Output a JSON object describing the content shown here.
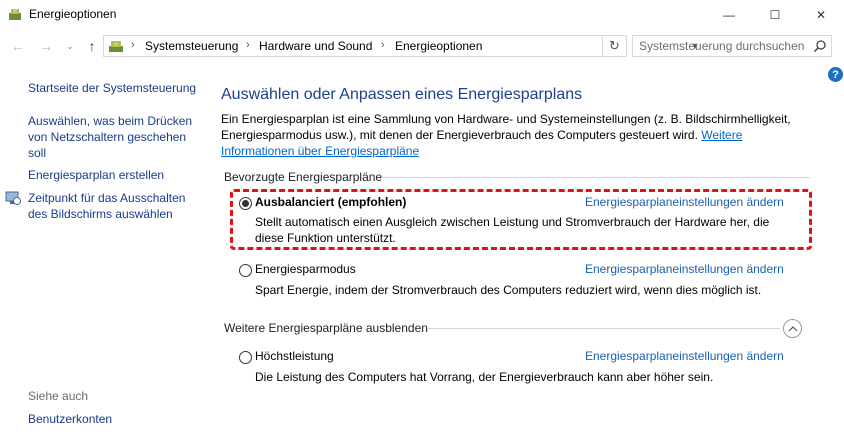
{
  "window": {
    "title": "Energieoptionen",
    "controls": {
      "minimize": "—",
      "maximize": "☐",
      "close": "✕"
    }
  },
  "navigation": {
    "back_icon": "←",
    "forward_icon": "→",
    "recent_icon": "⌄",
    "up_icon": "↑",
    "breadcrumbs": [
      "Systemsteuerung",
      "Hardware und Sound",
      "Energieoptionen"
    ],
    "refresh_icon": "↻",
    "search_placeholder": "Systemsteuerung durchsuchen"
  },
  "help": {
    "label": "?"
  },
  "sidebar": {
    "links": [
      "Startseite der Systemsteuerung",
      "Auswählen, was beim Drücken von Netzschaltern geschehen soll",
      "Energiesparplan erstellen",
      "Zeitpunkt für das Ausschalten des Bildschirms auswählen"
    ],
    "see_also_label": "Siehe auch",
    "see_also_links": [
      "Benutzerkonten"
    ]
  },
  "main": {
    "heading": "Auswählen oder Anpassen eines Energiesparplans",
    "intro_text": "Ein Energiesparplan ist eine Sammlung von Hardware- und Systemeinstellungen (z. B. Bildschirmhelligkeit, Energiesparmodus usw.), mit denen der Energieverbrauch des Computers gesteuert wird. ",
    "intro_link": "Weitere Informationen über Energiesparpläne",
    "preferred_section": "Bevorzugte Energiesparpläne",
    "more_section": "Weitere Energiesparpläne ausblenden",
    "change_link": "Energiesparplaneinstellungen ändern",
    "plans": [
      {
        "name": "Ausbalanciert (empfohlen)",
        "selected": true,
        "description": "Stellt automatisch einen Ausgleich zwischen Leistung und Stromverbrauch der Hardware her, die diese Funktion unterstützt."
      },
      {
        "name": "Energiesparmodus",
        "selected": false,
        "description": "Spart Energie, indem der Stromverbrauch des Computers reduziert wird, wenn dies möglich ist."
      },
      {
        "name": "Höchstleistung",
        "selected": false,
        "description": "Die Leistung des Computers hat Vorrang, der Energieverbrauch kann aber höher sein."
      }
    ]
  },
  "colors": {
    "accent": "#1e3f8c",
    "link": "#1a5fb4",
    "highlight_border": "#e01212"
  }
}
